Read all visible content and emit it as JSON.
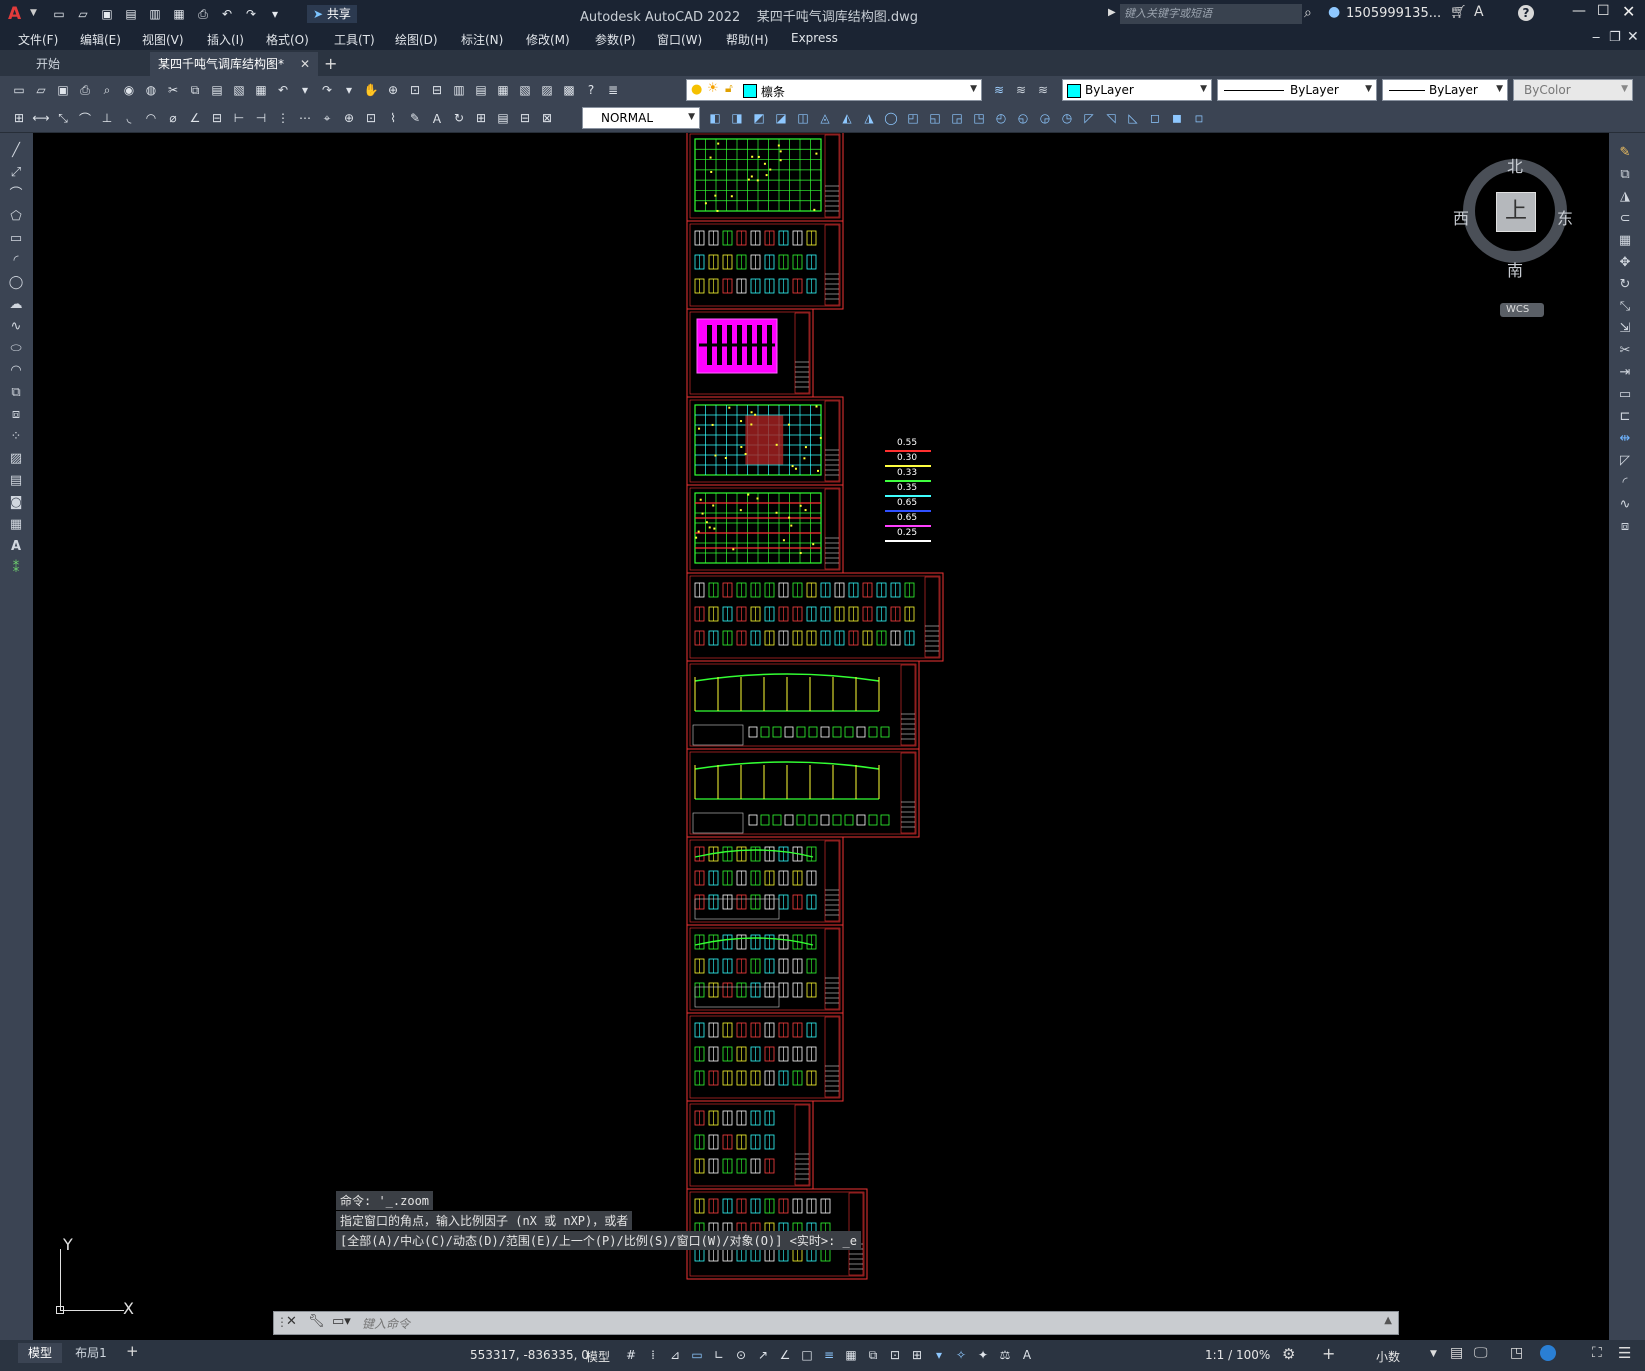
{
  "app": {
    "title": "Autodesk AutoCAD 2022    某四千吨气调库结构图.dwg",
    "share_label": "共享",
    "search_placeholder": "键入关键字或短语",
    "user": "1505999135...",
    "help_icon": "?"
  },
  "menu": [
    "文件(F)",
    "编辑(E)",
    "视图(V)",
    "插入(I)",
    "格式(O)",
    "工具(T)",
    "绘图(D)",
    "标注(N)",
    "修改(M)",
    "参数(P)",
    "窗口(W)",
    "帮助(H)",
    "Express"
  ],
  "tabs": {
    "start": "开始",
    "active": "某四千吨气调库结构图*",
    "add": "+"
  },
  "toolbar": {
    "layer_name": "檩条",
    "color": "ByLayer",
    "linetype": "ByLayer",
    "lineweight": "ByLayer",
    "plotstyle": "ByColor",
    "dimstyle": "NORMAL"
  },
  "viewcube": {
    "north": "北",
    "south": "南",
    "east": "东",
    "west": "西",
    "top": "上",
    "wcs": "WCS"
  },
  "ucs": {
    "x": "X",
    "y": "Y"
  },
  "legend": {
    "items": [
      {
        "value": "0.55",
        "color": "#ff3030"
      },
      {
        "value": "0.30",
        "color": "#ffff40"
      },
      {
        "value": "0.33",
        "color": "#40ff40"
      },
      {
        "value": "0.35",
        "color": "#40ffff"
      },
      {
        "value": "0.65",
        "color": "#3050ff"
      },
      {
        "value": "0.65",
        "color": "#ff40ff"
      },
      {
        "value": "0.25",
        "color": "#ffffff"
      }
    ]
  },
  "command": {
    "history": [
      "命令: '_.zoom",
      "指定窗口的角点，输入比例因子 (nX 或 nXP)，或者",
      "[全部(A)/中心(C)/动态(D)/范围(E)/上一个(P)/比例(S)/窗口(W)/对象(O)] <实时>: _e"
    ],
    "placeholder": "键入命令"
  },
  "layouts": {
    "model": "模型",
    "layout1": "布局1",
    "add": "+"
  },
  "status": {
    "coords": "553317, -836335, 0",
    "space": "模型",
    "scale": "1:1 / 100%",
    "units": "小数"
  },
  "colors": {
    "accent": "#2a7fd4",
    "canvas": "#000000",
    "drawing_border": "#ee3333"
  }
}
